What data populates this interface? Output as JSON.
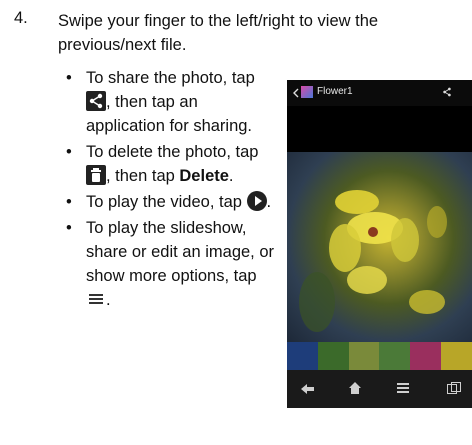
{
  "step": {
    "number": "4.",
    "text": "Swipe your finger to the left/right to view the previous/next file."
  },
  "bullets": [
    {
      "pre": "To share the photo, tap ",
      "icon": "share-icon",
      "post": ", then tap an application for sharing."
    },
    {
      "pre": "To delete the photo, tap ",
      "icon": "trash-icon",
      "post": ", then tap ",
      "bold": "Delete",
      "end": "."
    },
    {
      "pre": "To play the video, tap ",
      "icon": "play-icon",
      "post": "."
    },
    {
      "pre": "To play the slideshow, share or edit an image, or show more options, tap ",
      "icon": "menu-icon",
      "post": "."
    }
  ],
  "phone": {
    "title": "Flower1",
    "nav_icons": [
      "back-arrow-icon",
      "home-icon",
      "menu-icon",
      "recent-apps-icon"
    ],
    "thumb_colors": [
      "#1e3d7a",
      "#3b6a2a",
      "#7a8a3a",
      "#4b7a38",
      "#9a2f5e",
      "#b8a628"
    ]
  }
}
